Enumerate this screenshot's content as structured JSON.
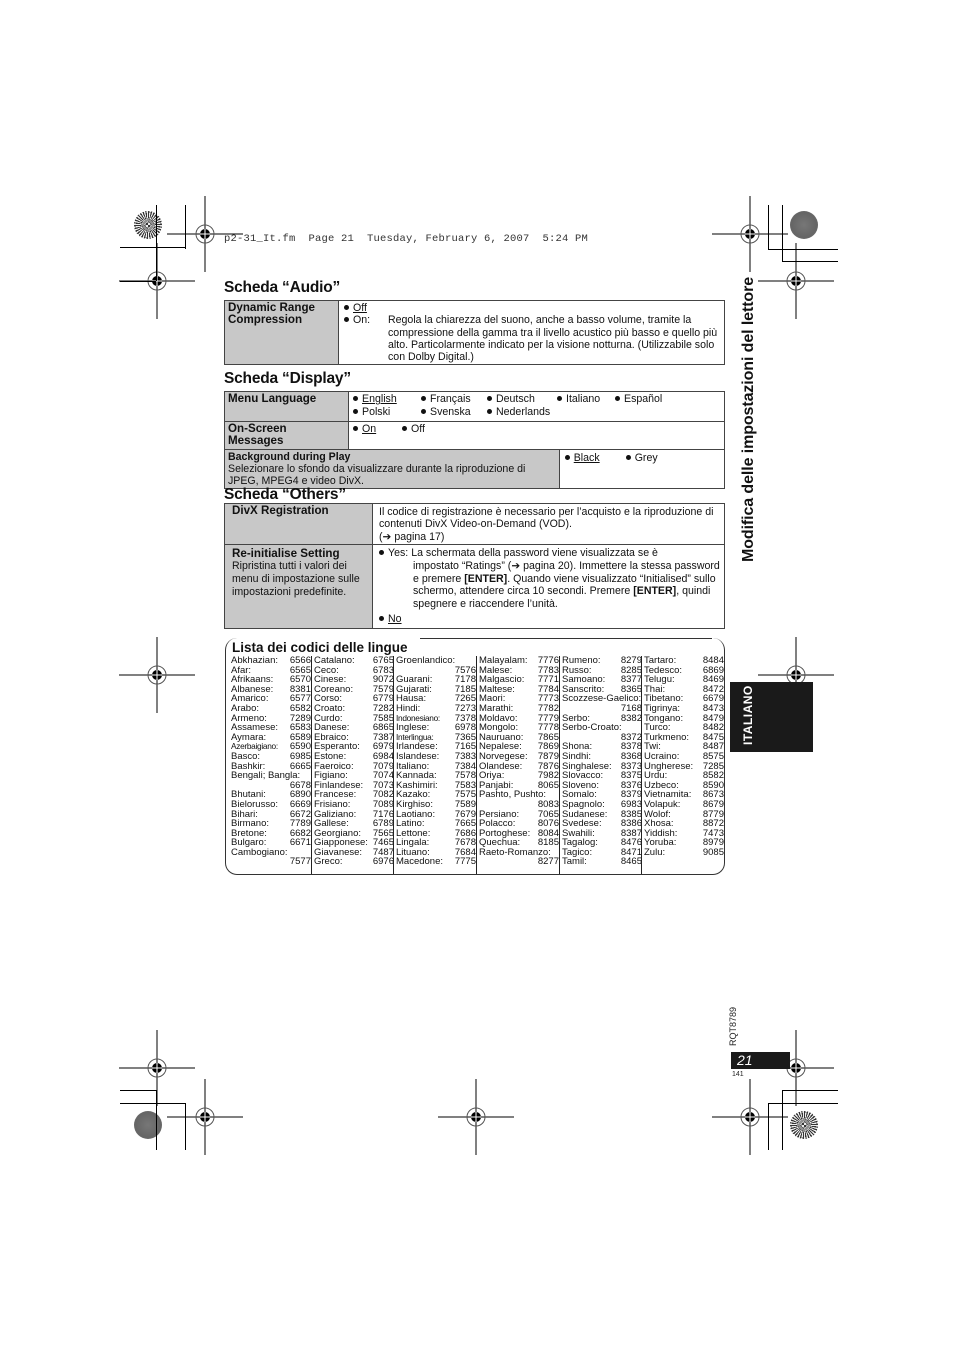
{
  "header_line": "p2-31_It.fm  Page 21  Tuesday, February 6, 2007  5:24 PM",
  "side_title": "Modifica delle impostazioni del lettore",
  "language_tab": "ITALIANO",
  "doc_code": "RQT8789",
  "page_number": "21",
  "page_sub": "141",
  "audio": {
    "title": "Scheda “Audio”",
    "rows": [
      {
        "label": "Dynamic Range Compression",
        "opt_off": "Off",
        "opt_on": "On:",
        "on_desc": "Regola la chiarezza del suono, anche a basso volume, tramite la compressione della gamma tra il livello acustico più basso e quello più alto. Particolarmente indicato per la visione notturna. (Utilizzabile solo con Dolby Digital.)"
      }
    ]
  },
  "display": {
    "title": "Scheda “Display”",
    "menu_language": {
      "label": "Menu Language",
      "options": [
        "English",
        "Français",
        "Deutsch",
        "Italiano",
        "Español",
        "Polski",
        "Svenska",
        "Nederlands"
      ],
      "default": "English"
    },
    "onscreen": {
      "label": "On-Screen Messages",
      "options": [
        "On",
        "Off"
      ],
      "default": "On"
    },
    "background": {
      "label": "Background during Play",
      "desc": "Selezionare lo sfondo da visualizzare durante la riproduzione di JPEG, MPEG4 e video DivX.",
      "options": [
        "Black",
        "Grey"
      ],
      "default": "Black"
    }
  },
  "others": {
    "title": "Scheda “Others”",
    "divx": {
      "label": "DivX Registration",
      "desc_1": "Il codice di registrazione è necessario per l’acquisto e la riproduzione di contenuti DivX Video-on-Demand (VOD).",
      "desc_ref": "(➔ pagina 17)"
    },
    "reinit": {
      "label": "Re-initialise Setting",
      "desc": "Ripristina tutti i valori dei menu di impostazione sulle impostazioni predefinite.",
      "yes_label": "Yes:",
      "yes_text_1": "La schermata della password viene visualizzata se è",
      "yes_text_2": "impostato “Ratings” (➔ pagina 20). Immettere la stessa password e premere ",
      "enter": "[ENTER]",
      "yes_text_3": ". Quando viene visualizzato “Initialised” sullo schermo, attendere circa 10 secondi. Premere ",
      "yes_text_4": ", quindi spegnere e riaccendere l’unità.",
      "no_label": "No"
    }
  },
  "language_codes": {
    "title": "Lista dei codici delle lingue",
    "columns": [
      [
        [
          "Abkhazian:",
          "6566"
        ],
        [
          "Afar:",
          "6565"
        ],
        [
          "Afrikaans:",
          "6570"
        ],
        [
          "Albanese:",
          "8381"
        ],
        [
          "Amarico:",
          "6577"
        ],
        [
          "Arabo:",
          "6582"
        ],
        [
          "Armeno:",
          "7289"
        ],
        [
          "Assamese:",
          "6583"
        ],
        [
          "Aymara:",
          "6589"
        ],
        [
          "Azerbaigiano:",
          "6590"
        ],
        [
          "Basco:",
          "6985"
        ],
        [
          "Bashkir:",
          "6665"
        ],
        [
          "Bengali; Bangla:",
          ""
        ],
        [
          "",
          "6678"
        ],
        [
          "Bhutani:",
          "6890"
        ],
        [
          "Bielorusso:",
          "6669"
        ],
        [
          "Bihari:",
          "6672"
        ],
        [
          "Birmano:",
          "7789"
        ],
        [
          "Bretone:",
          "6682"
        ],
        [
          "Bulgaro:",
          "6671"
        ],
        [
          "Cambogiano:",
          ""
        ],
        [
          "",
          "7577"
        ]
      ],
      [
        [
          "Catalano:",
          "6765"
        ],
        [
          "Ceco:",
          "6783"
        ],
        [
          "Cinese:",
          "9072"
        ],
        [
          "Coreano:",
          "7579"
        ],
        [
          "Corso:",
          "6779"
        ],
        [
          "Croato:",
          "7282"
        ],
        [
          "Curdo:",
          "7585"
        ],
        [
          "Danese:",
          "6865"
        ],
        [
          "Ebraico:",
          "7387"
        ],
        [
          "Esperanto:",
          "6979"
        ],
        [
          "Estone:",
          "6984"
        ],
        [
          "Faeroico:",
          "7079"
        ],
        [
          "Figiano:",
          "7074"
        ],
        [
          "Finlandese:",
          "7073"
        ],
        [
          "Francese:",
          "7082"
        ],
        [
          "Frisiano:",
          "7089"
        ],
        [
          "Galiziano:",
          "7176"
        ],
        [
          "Gallese:",
          "6789"
        ],
        [
          "Georgiano:",
          "7565"
        ],
        [
          "Giapponese:",
          "7465"
        ],
        [
          "Giavanese:",
          "7487"
        ],
        [
          "Greco:",
          "6976"
        ]
      ],
      [
        [
          "Groenlandico:",
          ""
        ],
        [
          "",
          "7576"
        ],
        [
          "Guarani:",
          "7178"
        ],
        [
          "Gujarati:",
          "7185"
        ],
        [
          "Hausa:",
          "7265"
        ],
        [
          "Hindi:",
          "7273"
        ],
        [
          "Indonesiano:",
          "7378"
        ],
        [
          "Inglese:",
          "6978"
        ],
        [
          "Interlingua:",
          "7365"
        ],
        [
          "Irlandese:",
          "7165"
        ],
        [
          "Islandese:",
          "7383"
        ],
        [
          "Italiano:",
          "7384"
        ],
        [
          "Kannada:",
          "7578"
        ],
        [
          "Kashimiri:",
          "7583"
        ],
        [
          "Kazako:",
          "7575"
        ],
        [
          "Kirghiso:",
          "7589"
        ],
        [
          "Laotiano:",
          "7679"
        ],
        [
          "Latino:",
          "7665"
        ],
        [
          "Lettone:",
          "7686"
        ],
        [
          "Lingala:",
          "7678"
        ],
        [
          "Lituano:",
          "7684"
        ],
        [
          "Macedone:",
          "7775"
        ]
      ],
      [
        [
          "Malayalam:",
          "7776"
        ],
        [
          "Malese:",
          "7783"
        ],
        [
          "Malgascio:",
          "7771"
        ],
        [
          "Maltese:",
          "7784"
        ],
        [
          "Maori:",
          "7773"
        ],
        [
          "Marathi:",
          "7782"
        ],
        [
          "Moldavo:",
          "7779"
        ],
        [
          "Mongolo:",
          "7778"
        ],
        [
          "Nauruano:",
          "7865"
        ],
        [
          "Nepalese:",
          "7869"
        ],
        [
          "Norvegese:",
          "7879"
        ],
        [
          "Olandese:",
          "7876"
        ],
        [
          "Oriya:",
          "7982"
        ],
        [
          "Panjabi:",
          "8065"
        ],
        [
          "Pashto, Pushto:",
          ""
        ],
        [
          "",
          "8083"
        ],
        [
          "Persiano:",
          "7065"
        ],
        [
          "Polacco:",
          "8076"
        ],
        [
          "Portoghese:",
          "8084"
        ],
        [
          "Quechua:",
          "8185"
        ],
        [
          "Raeto-Romanzo:",
          ""
        ],
        [
          "",
          "8277"
        ]
      ],
      [
        [
          "Rumeno:",
          "8279"
        ],
        [
          "Russo:",
          "8285"
        ],
        [
          "Samoano:",
          "8377"
        ],
        [
          "Sanscrito:",
          "8365"
        ],
        [
          "Scozzese-Gaelico:",
          ""
        ],
        [
          "",
          "7168"
        ],
        [
          "Serbo:",
          "8382"
        ],
        [
          "Serbo-Croato:",
          ""
        ],
        [
          "",
          "8372"
        ],
        [
          "Shona:",
          "8378"
        ],
        [
          "Sindhi:",
          "8368"
        ],
        [
          "Singhalese:",
          "8373"
        ],
        [
          "Slovacco:",
          "8375"
        ],
        [
          "Sloveno:",
          "8376"
        ],
        [
          "Somalo:",
          "8379"
        ],
        [
          "Spagnolo:",
          "6983"
        ],
        [
          "Sudanese:",
          "8385"
        ],
        [
          "Svedese:",
          "8386"
        ],
        [
          "Swahili:",
          "8387"
        ],
        [
          "Tagalog:",
          "8476"
        ],
        [
          "Tagico:",
          "8471"
        ],
        [
          "Tamil:",
          "8465"
        ]
      ],
      [
        [
          "Tartaro:",
          "8484"
        ],
        [
          "Tedesco:",
          "6869"
        ],
        [
          "Telugu:",
          "8469"
        ],
        [
          "Thai:",
          "8472"
        ],
        [
          "Tibetano:",
          "6679"
        ],
        [
          "Tigrinya:",
          "8473"
        ],
        [
          "Tongano:",
          "8479"
        ],
        [
          "Turco:",
          "8482"
        ],
        [
          "Turkmeno:",
          "8475"
        ],
        [
          "Twi:",
          "8487"
        ],
        [
          "Ucraino:",
          "8575"
        ],
        [
          "Ungherese:",
          "7285"
        ],
        [
          "Urdu:",
          "8582"
        ],
        [
          "Uzbeco:",
          "8590"
        ],
        [
          "Vietnamita:",
          "8673"
        ],
        [
          "Volapuk:",
          "8679"
        ],
        [
          "Wolof:",
          "8779"
        ],
        [
          "Xhosa:",
          "8872"
        ],
        [
          "Yiddish:",
          "7473"
        ],
        [
          "Yoruba:",
          "8979"
        ],
        [
          "Zulu:",
          "9085"
        ],
        [
          "",
          ""
        ]
      ]
    ]
  }
}
